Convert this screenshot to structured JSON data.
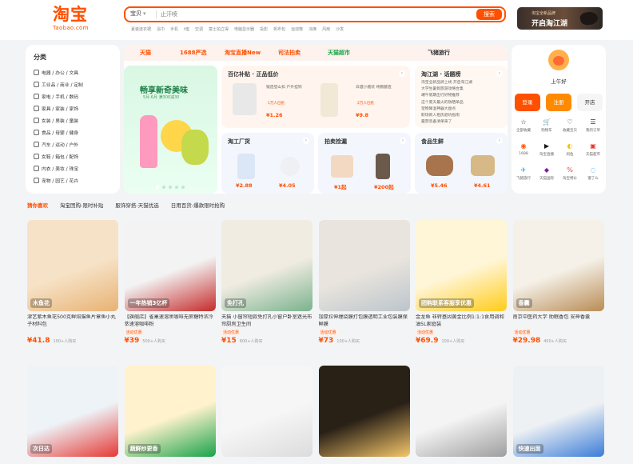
{
  "header": {
    "logo_main": "淘宝",
    "logo_sub": "Taobao.com",
    "search_scope": "宝贝",
    "search_placeholder": "止汗喷",
    "search_button": "搜索",
    "hot_words": [
      "夏装连衣裙",
      "浴巾",
      "手机",
      "t恤",
      "空调",
      "富士拍立得",
      "电脑显示器",
      "投影",
      "帆布包",
      "运动鞋",
      "凉席",
      "风扇",
      "沙发"
    ],
    "banner_line1": "淘宝全新品牌",
    "banner_line2": "开启淘江湖"
  },
  "categories": {
    "title": "分类",
    "rows": [
      "电器 / 办公 / 文具",
      "工业品 / 商业 / 定制",
      "家电 / 手机 / 数码",
      "家具 / 家装 / 家饰",
      "女装 / 男装 / 童装",
      "食品 / 母婴 / 健身",
      "汽车 / 运动 / 户外",
      "女鞋 / 箱包 / 配饰",
      "内衣 / 美妆 / 珠宝",
      "宠物 / 园艺 / 花卉"
    ]
  },
  "channels": [
    "天猫",
    "1688严选",
    "淘宝直播New",
    "司法拍卖",
    "天猫超市",
    "飞猪旅行",
    "飞猪旅行"
  ],
  "promo": {
    "title": "畅享新奇美味",
    "sub": "5月·6月 满300减30"
  },
  "sections": {
    "subsidy": {
      "title": "百亿补贴 · 正品低价",
      "items": [
        {
          "price": "¥1.26",
          "desc": "锻造登山扣 户外挂钩",
          "tag": "1万人已抢"
        },
        {
          "price": "¥9.8",
          "desc": "白酒小瓶装 纯粮酿造",
          "tag": "2万人已抢"
        }
      ]
    },
    "jianghu": {
      "title": "淘江湖 · 话题榜",
      "items": [
        "淘宝全新品牌上线 开启淘江湖",
        "大学生暑假旅游攻略合集",
        "端午假期出行好物推荐",
        "这个夏天最火的防晒单品",
        "宠物降温神器大盘点",
        "职场新人租房避坑指南",
        "露营装备清单来了"
      ]
    },
    "factory": {
      "title": "淘工厂货",
      "items": [
        {
          "price": "¥2.88"
        },
        {
          "price": "¥4.05"
        }
      ]
    },
    "auction": {
      "title": "拍卖捡漏",
      "items": [
        {
          "price": "¥1起"
        },
        {
          "price": "¥200起"
        }
      ]
    },
    "fresh": {
      "title": "食品生鲜",
      "items": [
        {
          "price": "¥5.46"
        },
        {
          "price": "¥4.61"
        }
      ]
    }
  },
  "user": {
    "greeting": "上午好",
    "login": "登录",
    "register": "注册",
    "open_shop": "开店",
    "shortcuts": [
      "全部收藏",
      "购物车",
      "收藏宝贝",
      "我的订单",
      "1688",
      "淘宝直播",
      "闲鱼",
      "天猫超市",
      "飞猪旅行",
      "天猫国际",
      "淘宝特价",
      "饿了么"
    ]
  },
  "feed_tabs": [
    "猜你喜欢",
    "淘宝团购-限时补贴",
    "服饰穿搭-天猫优选",
    "日用百货-爆款限时抢购"
  ],
  "products": [
    {
      "title": "津艺紫木鱼花500克鲜焙猫鱼片章鱼小丸子材料包",
      "badge": "",
      "price": "¥41.8",
      "sold": "100+人购买",
      "colors": [
        "#f6e2c6",
        "#e8b273"
      ],
      "label": "木鱼花"
    },
    {
      "title": "【旗舰店】雀巢速溶黑咖啡无蔗糖特浓冷萃速溶咖啡粉",
      "badge": "活动优惠",
      "price": "¥39",
      "sold": "500+人购买",
      "colors": [
        "#f3f3f3",
        "#c62b2b"
      ],
      "label": "一年热销3亿杯"
    },
    {
      "title": "天猫 小窗帘短款免打孔小窗户卧室遮光布帘厨房卫生间",
      "badge": "活动优惠",
      "price": "¥15",
      "sold": "600+人购买",
      "colors": [
        "#f1ece2",
        "#7ab38d"
      ],
      "label": "免打孔"
    },
    {
      "title": "加厚拉伸缠绕膜打包膜透明工业包装膜保鲜膜",
      "badge": "活动优惠",
      "price": "¥73",
      "sold": "100+人购买",
      "colors": [
        "#e9e4dd",
        "#bcc5cc"
      ],
      "label": ""
    },
    {
      "title": "金龙鱼 非转基因黄金比例1:1:1食用调和油5L家庭装",
      "badge": "活动优惠",
      "price": "¥69.9",
      "sold": "100+人购买",
      "colors": [
        "#fff6d8",
        "#ffcc1a"
      ],
      "label": "团购联系客服享优惠"
    },
    {
      "title": "南京中医药大学 助眠香包 安神香囊",
      "badge": "活动优惠",
      "price": "¥29.98",
      "sold": "400+人购买",
      "colors": [
        "#f5f1e8",
        "#b98c55"
      ],
      "label": "香囊"
    },
    {
      "title": "",
      "badge": "",
      "price": "",
      "sold": "",
      "colors": [
        "#eef3f8",
        "#e53935"
      ],
      "label": "次日达"
    },
    {
      "title": "",
      "badge": "",
      "price": "",
      "sold": "",
      "colors": [
        "#fff2cc",
        "#1aa34a"
      ],
      "label": "蔬鲜炒更香"
    },
    {
      "title": "",
      "badge": "",
      "price": "",
      "sold": "",
      "colors": [
        "#f6f6f6",
        "#dcdcdc"
      ],
      "label": ""
    },
    {
      "title": "",
      "badge": "",
      "price": "",
      "sold": "",
      "colors": [
        "#2a2116",
        "#f5c76b"
      ],
      "label": ""
    },
    {
      "title": "",
      "badge": "",
      "price": "",
      "sold": "",
      "colors": [
        "#f4f4f4",
        "#9e9e9e"
      ],
      "label": ""
    },
    {
      "title": "",
      "badge": "",
      "price": "",
      "sold": "",
      "colors": [
        "#eef1f4",
        "#3b7dd8"
      ],
      "label": "快速出面"
    }
  ]
}
